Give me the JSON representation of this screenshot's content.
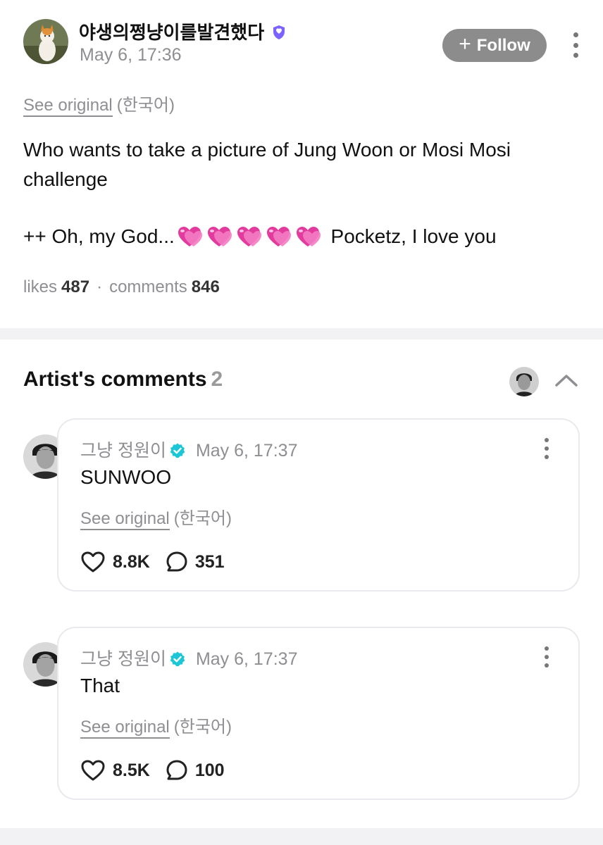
{
  "post": {
    "username": "야생의쩡냥이를발견했다",
    "timestamp": "May 6, 17:36",
    "follow_label": "Follow",
    "see_original": "See original",
    "original_lang": "(한국어)",
    "body_line1": "Who wants to take a picture of Jung Woon or Mosi Mosi challenge",
    "body_line2_prefix": "++ Oh, my God...",
    "body_line2_suffix": "Pocketz, I love you",
    "heart_emoji_count": 5,
    "likes_label": "likes",
    "likes_count": "487",
    "comments_label": "comments",
    "comments_count": "846"
  },
  "artist_comments": {
    "title": "Artist's comments",
    "count": "2",
    "items": [
      {
        "author": "그냥 정원이",
        "timestamp": "May 6, 17:37",
        "text": "SUNWOO",
        "see_original": "See original",
        "original_lang": "(한국어)",
        "likes": "8.8K",
        "replies": "351"
      },
      {
        "author": "그냥 정원이",
        "timestamp": "May 6, 17:37",
        "text": "That",
        "see_original": "See original",
        "original_lang": "(한국어)",
        "likes": "8.5K",
        "replies": "100"
      }
    ]
  },
  "colors": {
    "follow_button_bg": "#8c8c8c",
    "muted_text": "#8e8e93",
    "verified_user_badge": "#7a63ff",
    "verified_artist_badge": "#1dc6d6",
    "heart_emoji": "#e23a9d",
    "divider": "#f2f2f4"
  },
  "icons": {
    "post_author_badge": "verified-shield-icon",
    "artist_badge": "verified-check-icon",
    "like": "heart-outline-icon",
    "reply": "speech-bubble-icon",
    "menu": "more-vertical-icon",
    "collapse": "chevron-up-icon"
  }
}
